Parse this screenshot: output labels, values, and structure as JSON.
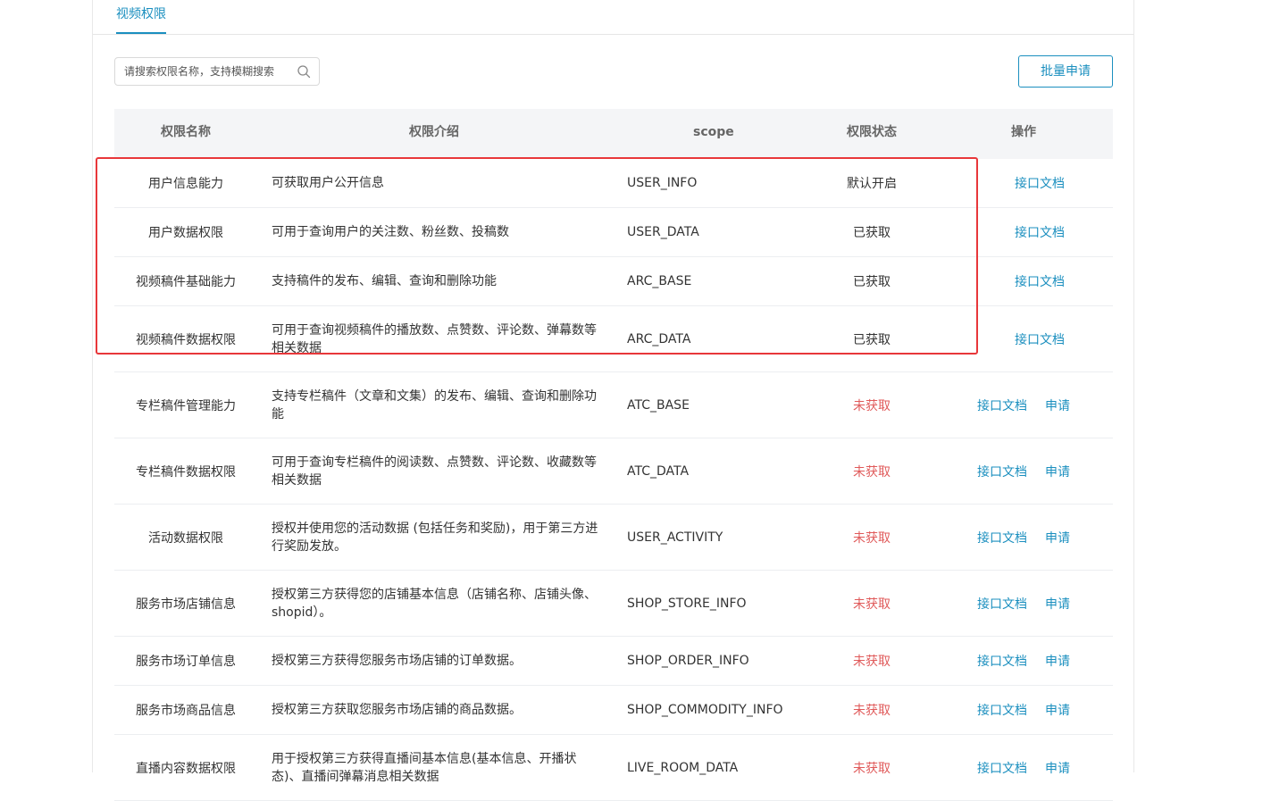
{
  "tabs": [
    {
      "label": "视频权限"
    }
  ],
  "search": {
    "placeholder": "请搜索权限名称，支持模糊搜索",
    "icon": "search-icon"
  },
  "toolbar": {
    "batch_apply_label": "批量申请"
  },
  "table": {
    "headers": {
      "name": "权限名称",
      "desc": "权限介绍",
      "scope": "scope",
      "status": "权限状态",
      "ops": "操作"
    },
    "rows": [
      {
        "name": "用户信息能力",
        "desc": "可获取用户公开信息",
        "scope": "USER_INFO",
        "status": "默认开启",
        "status_type": "ok",
        "doc": "接口文档",
        "apply": ""
      },
      {
        "name": "用户数据权限",
        "desc": "可用于查询用户的关注数、粉丝数、投稿数",
        "scope": "USER_DATA",
        "status": "已获取",
        "status_type": "ok",
        "doc": "接口文档",
        "apply": ""
      },
      {
        "name": "视频稿件基础能力",
        "desc": "支持稿件的发布、编辑、查询和删除功能",
        "scope": "ARC_BASE",
        "status": "已获取",
        "status_type": "ok",
        "doc": "接口文档",
        "apply": ""
      },
      {
        "name": "视频稿件数据权限",
        "desc": "可用于查询视频稿件的播放数、点赞数、评论数、弹幕数等相关数据",
        "scope": "ARC_DATA",
        "status": "已获取",
        "status_type": "ok",
        "doc": "接口文档",
        "apply": ""
      },
      {
        "name": "专栏稿件管理能力",
        "desc": "支持专栏稿件（文章和文集）的发布、编辑、查询和删除功能",
        "scope": "ATC_BASE",
        "status": "未获取",
        "status_type": "no",
        "doc": "接口文档",
        "apply": "申请"
      },
      {
        "name": "专栏稿件数据权限",
        "desc": "可用于查询专栏稿件的阅读数、点赞数、评论数、收藏数等相关数据",
        "scope": "ATC_DATA",
        "status": "未获取",
        "status_type": "no",
        "doc": "接口文档",
        "apply": "申请"
      },
      {
        "name": "活动数据权限",
        "desc": "授权并使用您的活动数据 (包括任务和奖励)，用于第三方进行奖励发放。",
        "scope": "USER_ACTIVITY",
        "status": "未获取",
        "status_type": "no",
        "doc": "接口文档",
        "apply": "申请"
      },
      {
        "name": "服务市场店铺信息",
        "desc": "授权第三方获得您的店铺基本信息（店铺名称、店铺头像、shopid）。",
        "scope": "SHOP_STORE_INFO",
        "status": "未获取",
        "status_type": "no",
        "doc": "接口文档",
        "apply": "申请"
      },
      {
        "name": "服务市场订单信息",
        "desc": "授权第三方获得您服务市场店铺的订单数据。",
        "scope": "SHOP_ORDER_INFO",
        "status": "未获取",
        "status_type": "no",
        "doc": "接口文档",
        "apply": "申请"
      },
      {
        "name": "服务市场商品信息",
        "desc": "授权第三方获取您服务市场店铺的商品数据。",
        "scope": "SHOP_COMMODITY_INFO",
        "status": "未获取",
        "status_type": "no",
        "doc": "接口文档",
        "apply": "申请"
      },
      {
        "name": "直播内容数据权限",
        "desc": "用于授权第三方获得直播间基本信息(基本信息、开播状态)、直播间弹幕消息相关数据",
        "scope": "LIVE_ROOM_DATA",
        "status": "未获取",
        "status_type": "no",
        "doc": "接口文档",
        "apply": "申请"
      }
    ]
  },
  "colors": {
    "accent": "#1b8fbf",
    "not_obtained": "#e05a5a",
    "highlight": "#e8373a",
    "header_bg": "#f4f5f7"
  }
}
